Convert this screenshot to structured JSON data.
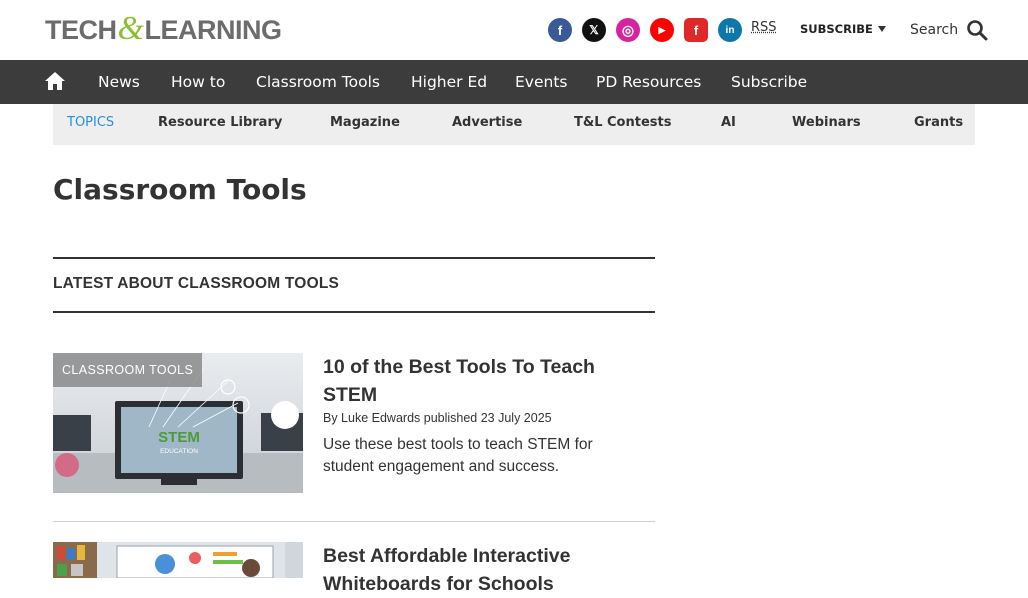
{
  "brand": {
    "logo_left": "TECH",
    "logo_amp": "&",
    "logo_right": "LEARNING"
  },
  "header": {
    "socials": [
      {
        "name": "facebook",
        "glyph": "f",
        "color": "#3b5998"
      },
      {
        "name": "x",
        "glyph": "𝕏",
        "color": "#111111"
      },
      {
        "name": "instagram",
        "glyph": "◎",
        "color": "#d6249f"
      },
      {
        "name": "youtube",
        "glyph": "▶",
        "color": "#ff0000"
      },
      {
        "name": "flipboard",
        "glyph": "f",
        "color": "#e12828"
      },
      {
        "name": "linkedin",
        "glyph": "in",
        "color": "#0e76a8"
      }
    ],
    "rss_label": "RSS",
    "subscribe_label": "SUBSCRIBE",
    "search_label": "Search"
  },
  "nav": {
    "items": [
      {
        "label": "News"
      },
      {
        "label": "How to"
      },
      {
        "label": "Classroom Tools"
      },
      {
        "label": "Higher Ed"
      },
      {
        "label": "Events"
      },
      {
        "label": "PD Resources"
      },
      {
        "label": "Subscribe"
      }
    ]
  },
  "subnav": {
    "topics_label": "TOPICS",
    "items": [
      {
        "label": "Resource Library"
      },
      {
        "label": "Magazine"
      },
      {
        "label": "Advertise"
      },
      {
        "label": "T&L Contests"
      },
      {
        "label": "AI"
      },
      {
        "label": "Webinars"
      },
      {
        "label": "Grants"
      }
    ]
  },
  "page": {
    "title": "Classroom Tools",
    "section_heading": "LATEST ABOUT CLASSROOM TOOLS"
  },
  "articles": [
    {
      "badge": "CLASSROOM TOOLS",
      "title": "10 of the Best Tools To Teach STEM",
      "byline": "By Luke Edwards published 23 July 2025",
      "summary": "Use these best tools to teach STEM for student engagement and success.",
      "thumb_text_main": "STEM",
      "thumb_text_sub": "EDUCATION"
    },
    {
      "title": "Best Affordable Interactive Whiteboards for Schools"
    }
  ]
}
